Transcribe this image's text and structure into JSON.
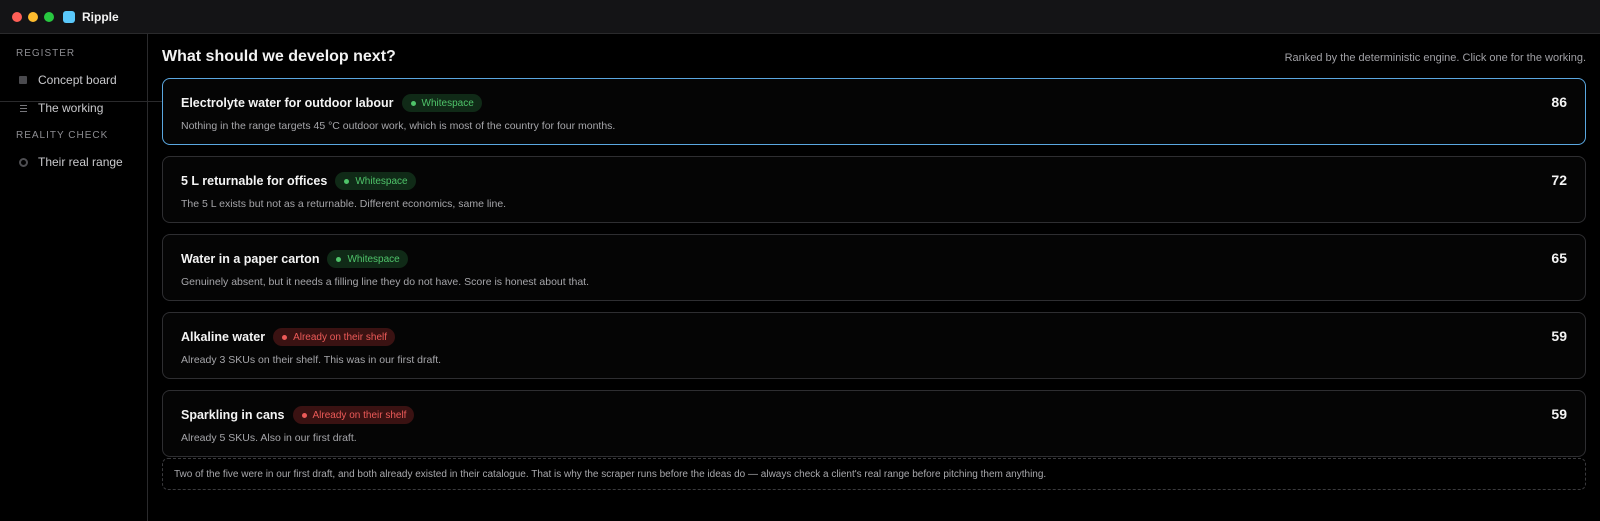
{
  "window": {
    "app_name": "Ripple",
    "traffic_colors": [
      "#ff5f57",
      "#febc2e",
      "#28c840"
    ]
  },
  "sidebar": {
    "sections": [
      {
        "label": "REGISTER",
        "items": [
          {
            "label": "Concept board",
            "icon": "board-icon"
          },
          {
            "label": "The working",
            "icon": "list-icon"
          }
        ]
      },
      {
        "label": "REALITY CHECK",
        "items": [
          {
            "label": "Their real range",
            "icon": "circle-icon"
          }
        ]
      }
    ]
  },
  "main": {
    "title": "What should we develop next?",
    "subtitle": "Ranked by the deterministic engine. Click one for the working.",
    "cards": [
      {
        "title": "Electrolyte water for outdoor labour",
        "badge": "Whitespace",
        "badge_type": "green",
        "description": "Nothing in the range targets 45 °C outdoor work, which is most of the country for four months.",
        "score": "86",
        "selected": true
      },
      {
        "title": "5 L returnable for offices",
        "badge": "Whitespace",
        "badge_type": "green",
        "description": "The 5 L exists but not as a returnable. Different economics, same line.",
        "score": "72",
        "selected": false
      },
      {
        "title": "Water in a paper carton",
        "badge": "Whitespace",
        "badge_type": "green",
        "description": "Genuinely absent, but it needs a filling line they do not have. Score is honest about that.",
        "score": "65",
        "selected": false
      },
      {
        "title": "Alkaline water",
        "badge": "Already on their shelf",
        "badge_type": "red",
        "description": "Already 3 SKUs on their shelf. This was in our first draft.",
        "score": "59",
        "selected": false
      },
      {
        "title": "Sparkling in cans",
        "badge": "Already on their shelf",
        "badge_type": "red",
        "description": "Already 5 SKUs. Also in our first draft.",
        "score": "59",
        "selected": false
      }
    ],
    "note": "Two of the five were in our first draft, and both already existed in their catalogue. That is why the scraper runs before the ideas do — always check a client's real range before pitching them anything."
  },
  "colors": {
    "accent": "#5aa7e0",
    "whitespace_green": "#4fc46a",
    "shelf_red": "#ec5a58",
    "app_logo": "#5ac8fa"
  }
}
